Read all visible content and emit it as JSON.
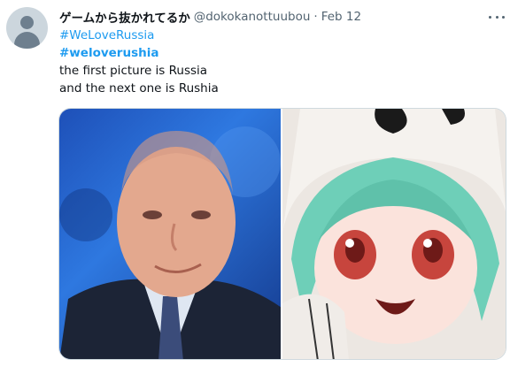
{
  "tweet": {
    "display_name": "ゲームから抜かれてるか",
    "handle": "@dokokanottuubou",
    "separator": "·",
    "date": "Feb 12",
    "lines": [
      "#WeLoveRussia",
      "#weloverushia",
      "the first picture is Russia",
      "and the next one is Rushia"
    ]
  },
  "icons": {
    "avatar": "default-avatar-icon",
    "more": "more-horizontal-icon"
  },
  "colors": {
    "link": "#1d9bf0",
    "text": "#0f1419",
    "secondary": "#536471"
  }
}
